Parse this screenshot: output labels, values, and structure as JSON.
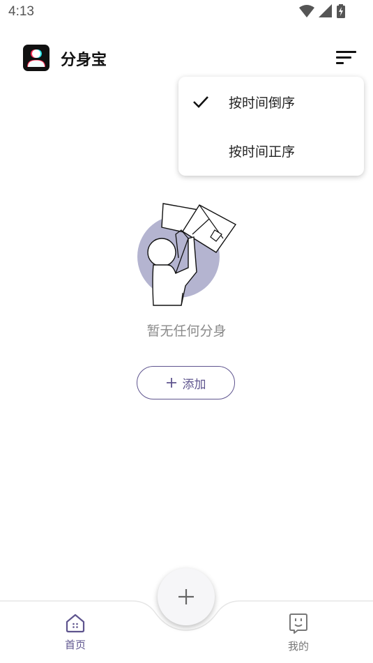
{
  "status_bar": {
    "time": "4:13",
    "icons": [
      "wifi-icon",
      "cell-signal-icon",
      "battery-charging-icon"
    ]
  },
  "header": {
    "title": "分身宝",
    "logo_icon": "app-logo-icon",
    "sort_icon": "sort-icon"
  },
  "sort_menu": {
    "items": [
      {
        "label": "按时间倒序",
        "selected": true
      },
      {
        "label": "按时间正序",
        "selected": false
      }
    ]
  },
  "empty_state": {
    "message": "暂无任何分身",
    "add_button_label": "添加",
    "illustration_icon": "person-lifting-box-illustration"
  },
  "bottom_nav": {
    "items": [
      {
        "label": "首页",
        "icon": "home-icon",
        "active": true
      },
      {
        "label": "我的",
        "icon": "profile-face-icon",
        "active": false
      }
    ],
    "fab_icon": "plus-icon"
  },
  "colors": {
    "accent": "#5e548e",
    "illustration_circle": "#b4b4d0",
    "muted_text": "#8a8a8a"
  }
}
